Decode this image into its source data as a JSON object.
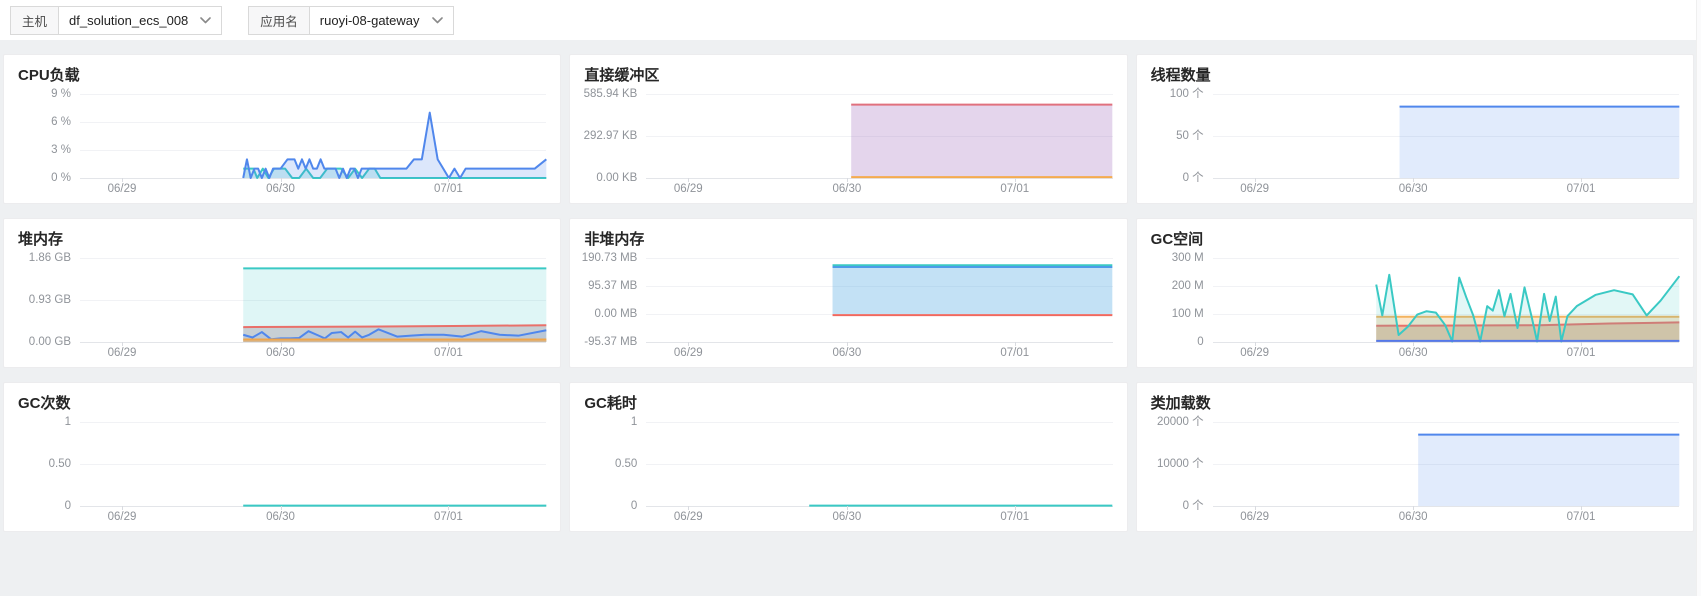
{
  "toolbar": {
    "host": {
      "label": "主机",
      "value": "df_solution_ecs_008"
    },
    "app": {
      "label": "应用名",
      "value": "ruoyi-08-gateway"
    }
  },
  "xaxis": {
    "labels": [
      "06/29",
      "06/30",
      "07/01"
    ],
    "positions": [
      0.09,
      0.43,
      0.79
    ]
  },
  "chart_data": [
    {
      "id": "cpu-load",
      "title": "CPU负载",
      "type": "area",
      "ylim": [
        0,
        9
      ],
      "yticks": [
        {
          "value": 0,
          "label": "0 %"
        },
        {
          "value": 3,
          "label": "3 %"
        },
        {
          "value": 6,
          "label": "6 %"
        },
        {
          "value": 9,
          "label": "9 %"
        }
      ],
      "series": [
        {
          "color": "#3AC9C4",
          "fill": "rgba(58,201,196,0.20)",
          "points": [
            [
              0.35,
              1
            ],
            [
              0.372,
              1
            ],
            [
              0.38,
              0
            ],
            [
              0.392,
              1
            ],
            [
              0.404,
              0
            ],
            [
              0.416,
              1
            ],
            [
              0.428,
              1
            ],
            [
              0.44,
              1
            ],
            [
              0.455,
              0
            ],
            [
              0.47,
              0
            ],
            [
              0.485,
              1
            ],
            [
              0.5,
              0
            ],
            [
              0.515,
              0
            ],
            [
              0.53,
              1
            ],
            [
              0.56,
              1
            ],
            [
              0.575,
              0
            ],
            [
              0.59,
              1
            ],
            [
              0.605,
              0
            ],
            [
              0.62,
              1
            ],
            [
              0.632,
              1
            ],
            [
              0.644,
              0
            ],
            [
              0.68,
              0
            ],
            [
              0.72,
              0
            ],
            [
              0.76,
              0
            ],
            [
              0.86,
              0
            ],
            [
              1.0,
              0
            ]
          ]
        },
        {
          "color": "#5087EC",
          "fill": "rgba(80,135,236,0.20)",
          "points": [
            [
              0.35,
              0
            ],
            [
              0.358,
              2
            ],
            [
              0.366,
              0
            ],
            [
              0.374,
              1
            ],
            [
              0.382,
              1
            ],
            [
              0.39,
              0
            ],
            [
              0.398,
              1
            ],
            [
              0.406,
              0
            ],
            [
              0.414,
              1
            ],
            [
              0.422,
              1
            ],
            [
              0.43,
              1
            ],
            [
              0.445,
              2
            ],
            [
              0.46,
              2
            ],
            [
              0.468,
              1
            ],
            [
              0.476,
              2
            ],
            [
              0.484,
              1
            ],
            [
              0.492,
              2
            ],
            [
              0.5,
              1
            ],
            [
              0.508,
              1
            ],
            [
              0.516,
              2
            ],
            [
              0.524,
              1
            ],
            [
              0.532,
              1
            ],
            [
              0.548,
              1
            ],
            [
              0.556,
              0
            ],
            [
              0.564,
              1
            ],
            [
              0.572,
              0
            ],
            [
              0.58,
              1
            ],
            [
              0.588,
              1
            ],
            [
              0.596,
              0
            ],
            [
              0.604,
              1
            ],
            [
              0.612,
              1
            ],
            [
              0.62,
              1
            ],
            [
              0.636,
              1
            ],
            [
              0.652,
              1
            ],
            [
              0.668,
              1
            ],
            [
              0.684,
              1
            ],
            [
              0.7,
              1
            ],
            [
              0.716,
              2
            ],
            [
              0.733,
              2
            ],
            [
              0.75,
              7
            ],
            [
              0.767,
              2
            ],
            [
              0.779,
              1
            ],
            [
              0.791,
              0
            ],
            [
              0.803,
              1
            ],
            [
              0.815,
              0
            ],
            [
              0.827,
              1
            ],
            [
              0.839,
              1
            ],
            [
              0.867,
              1
            ],
            [
              0.895,
              1
            ],
            [
              0.923,
              1
            ],
            [
              0.951,
              1
            ],
            [
              0.975,
              1
            ],
            [
              1.0,
              2
            ]
          ]
        }
      ]
    },
    {
      "id": "direct-buffer",
      "title": "直接缓冲区",
      "type": "area",
      "ylim": [
        0,
        585.94
      ],
      "yticks": [
        {
          "value": 0,
          "label": "0.00 KB"
        },
        {
          "value": 292.97,
          "label": "292.97 KB"
        },
        {
          "value": 585.94,
          "label": "585.94 KB"
        }
      ],
      "series": [
        {
          "color": "#E0707E",
          "fill": "rgba(170,125,195,0.32)",
          "points": [
            [
              0.44,
              512
            ],
            [
              1.0,
              512
            ]
          ]
        },
        {
          "color": "#F5AB4E",
          "points": [
            [
              0.44,
              6
            ],
            [
              1.0,
              6
            ]
          ]
        }
      ]
    },
    {
      "id": "thread-count",
      "title": "线程数量",
      "type": "area",
      "ylim": [
        0,
        100
      ],
      "yticks": [
        {
          "value": 0,
          "label": "0 个"
        },
        {
          "value": 50,
          "label": "50 个"
        },
        {
          "value": 100,
          "label": "100 个"
        }
      ],
      "series": [
        {
          "color": "#5087EC",
          "fill": "rgba(80,135,236,0.17)",
          "points": [
            [
              0.4,
              85
            ],
            [
              1.0,
              85
            ]
          ]
        }
      ]
    },
    {
      "id": "heap-memory",
      "title": "堆内存",
      "type": "area",
      "ylim": [
        0,
        1.86
      ],
      "yticks": [
        {
          "value": 0,
          "label": "0.00 GB"
        },
        {
          "value": 0.93,
          "label": "0.93 GB"
        },
        {
          "value": 1.86,
          "label": "1.86 GB"
        }
      ],
      "series": [
        {
          "color": "#3AC9C4",
          "fill": "rgba(58,201,196,0.16)",
          "points": [
            [
              0.35,
              1.63
            ],
            [
              1.0,
              1.63
            ]
          ]
        },
        {
          "color": "#E9706A",
          "fill": "rgba(150,125,140,0.32)",
          "points": [
            [
              0.35,
              0.33
            ],
            [
              0.6,
              0.34
            ],
            [
              0.8,
              0.355
            ],
            [
              1.0,
              0.37
            ]
          ]
        },
        {
          "color": "#5087EC",
          "fill": "rgba(80,135,236,0.10)",
          "points": [
            [
              0.35,
              0.16
            ],
            [
              0.37,
              0.1
            ],
            [
              0.39,
              0.22
            ],
            [
              0.41,
              0.06
            ],
            [
              0.43,
              0.08
            ],
            [
              0.45,
              0.08
            ],
            [
              0.47,
              0.09
            ],
            [
              0.49,
              0.24
            ],
            [
              0.51,
              0.15
            ],
            [
              0.525,
              0.08
            ],
            [
              0.54,
              0.2
            ],
            [
              0.56,
              0.22
            ],
            [
              0.575,
              0.1
            ],
            [
              0.59,
              0.23
            ],
            [
              0.605,
              0.1
            ],
            [
              0.62,
              0.16
            ],
            [
              0.64,
              0.28
            ],
            [
              0.66,
              0.2
            ],
            [
              0.68,
              0.12
            ],
            [
              0.71,
              0.14
            ],
            [
              0.74,
              0.16
            ],
            [
              0.78,
              0.16
            ],
            [
              0.82,
              0.12
            ],
            [
              0.86,
              0.24
            ],
            [
              0.9,
              0.16
            ],
            [
              0.94,
              0.14
            ],
            [
              1.0,
              0.26
            ]
          ]
        },
        {
          "color": "#F0A64B",
          "fill": "rgba(240,166,75,0.45)",
          "points": [
            [
              0.35,
              0.055
            ],
            [
              1.0,
              0.055
            ]
          ]
        }
      ]
    },
    {
      "id": "non-heap-memory",
      "title": "非堆内存",
      "type": "area",
      "ylim": [
        -95.37,
        190.73
      ],
      "yticks": [
        {
          "value": -95.37,
          "label": "-95.37 MB"
        },
        {
          "value": 0,
          "label": "0.00 MB"
        },
        {
          "value": 95.37,
          "label": "95.37 MB"
        },
        {
          "value": 190.73,
          "label": "190.73 MB"
        }
      ],
      "series": [
        {
          "color": "#3AC9C4",
          "points": [
            [
              0.4,
              166
            ],
            [
              1.0,
              166
            ]
          ]
        },
        {
          "color": "#4D9BE8",
          "fill": "rgba(105,180,230,0.40)",
          "points": [
            [
              0.4,
              160
            ],
            [
              1.0,
              160
            ]
          ]
        },
        {
          "color": "#F0685F",
          "points": [
            [
              0.4,
              -4
            ],
            [
              1.0,
              -4
            ]
          ]
        }
      ]
    },
    {
      "id": "gc-space",
      "title": "GC空间",
      "type": "area",
      "ylim": [
        0,
        300
      ],
      "yticks": [
        {
          "value": 0,
          "label": "0"
        },
        {
          "value": 100,
          "label": "100 M"
        },
        {
          "value": 200,
          "label": "200 M"
        },
        {
          "value": 300,
          "label": "300 M"
        }
      ],
      "series": [
        {
          "color": "#F3B25F",
          "fill": "rgba(243,178,95,0.30)",
          "points": [
            [
              0.35,
              90
            ],
            [
              1.0,
              90
            ]
          ]
        },
        {
          "color": "#E9706A",
          "fill": "rgba(200,125,85,0.35)",
          "points": [
            [
              0.35,
              58
            ],
            [
              0.7,
              60
            ],
            [
              0.85,
              66
            ],
            [
              1.0,
              70
            ]
          ]
        },
        {
          "color": "#3AC9C4",
          "fill": "rgba(58,201,196,0.15)",
          "points": [
            [
              0.35,
              205
            ],
            [
              0.363,
              95
            ],
            [
              0.378,
              240
            ],
            [
              0.398,
              25
            ],
            [
              0.418,
              55
            ],
            [
              0.438,
              98
            ],
            [
              0.458,
              110
            ],
            [
              0.478,
              105
            ],
            [
              0.498,
              60
            ],
            [
              0.513,
              2
            ],
            [
              0.528,
              230
            ],
            [
              0.543,
              160
            ],
            [
              0.558,
              95
            ],
            [
              0.573,
              2
            ],
            [
              0.588,
              128
            ],
            [
              0.6,
              112
            ],
            [
              0.613,
              185
            ],
            [
              0.625,
              92
            ],
            [
              0.638,
              172
            ],
            [
              0.653,
              50
            ],
            [
              0.668,
              195
            ],
            [
              0.683,
              92
            ],
            [
              0.695,
              2
            ],
            [
              0.71,
              172
            ],
            [
              0.722,
              75
            ],
            [
              0.735,
              162
            ],
            [
              0.747,
              2
            ],
            [
              0.76,
              92
            ],
            [
              0.78,
              128
            ],
            [
              0.82,
              168
            ],
            [
              0.86,
              185
            ],
            [
              0.9,
              170
            ],
            [
              0.93,
              95
            ],
            [
              0.96,
              148
            ],
            [
              1.0,
              235
            ]
          ]
        },
        {
          "color": "#5578EA",
          "points": [
            [
              0.35,
              4
            ],
            [
              1.0,
              4
            ]
          ]
        }
      ]
    },
    {
      "id": "gc-count",
      "title": "GC次数",
      "type": "line",
      "ylim": [
        0,
        1
      ],
      "yticks": [
        {
          "value": 0,
          "label": "0"
        },
        {
          "value": 0.5,
          "label": "0.50"
        },
        {
          "value": 1,
          "label": "1"
        }
      ],
      "series": [
        {
          "color": "#3AC9C4",
          "points": [
            [
              0.35,
              0.004
            ],
            [
              1.0,
              0.004
            ]
          ]
        }
      ]
    },
    {
      "id": "gc-time",
      "title": "GC耗时",
      "type": "line",
      "ylim": [
        0,
        1
      ],
      "yticks": [
        {
          "value": 0,
          "label": "0"
        },
        {
          "value": 0.5,
          "label": "0.50"
        },
        {
          "value": 1,
          "label": "1"
        }
      ],
      "series": [
        {
          "color": "#3AC9C4",
          "points": [
            [
              0.35,
              0.004
            ],
            [
              1.0,
              0.004
            ]
          ]
        }
      ]
    },
    {
      "id": "class-loaded",
      "title": "类加载数",
      "type": "area",
      "ylim": [
        0,
        20000
      ],
      "yticks": [
        {
          "value": 0,
          "label": "0 个"
        },
        {
          "value": 10000,
          "label": "10000 个"
        },
        {
          "value": 20000,
          "label": "20000 个"
        }
      ],
      "series": [
        {
          "color": "#5087EC",
          "fill": "rgba(80,135,236,0.17)",
          "points": [
            [
              0.44,
              17000
            ],
            [
              1.0,
              17000
            ]
          ]
        }
      ]
    }
  ]
}
